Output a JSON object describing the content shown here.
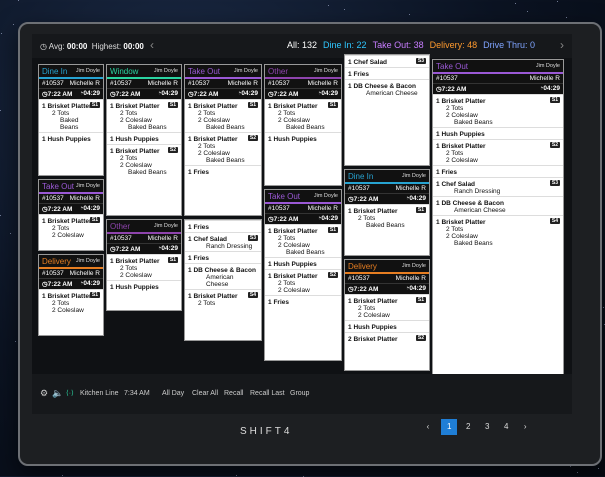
{
  "topbar": {
    "avg_label": "Avg:",
    "avg": "00:00",
    "highest_label": "Highest:",
    "highest": "00:00",
    "filters": [
      {
        "label": "All:",
        "count": "132",
        "color": "#ffffff"
      },
      {
        "label": "Dine In:",
        "count": "22",
        "color": "#2fc7ff"
      },
      {
        "label": "Take Out:",
        "count": "38",
        "color": "#c77dff"
      },
      {
        "label": "Delivery:",
        "count": "48",
        "color": "#ff9a2e"
      },
      {
        "label": "Drive Thru:",
        "count": "0",
        "color": "#7fa4ff"
      }
    ]
  },
  "tickets": [
    {
      "type": "Dine In",
      "color": "#27a3d1",
      "server": "Jim Doyle",
      "num": "#10537",
      "cust": "Michelle R",
      "time": "7:22 AM",
      "elapsed": "04:29",
      "items": [
        {
          "q": "1",
          "name": "Brisket Platter",
          "tag": "S1",
          "subs": [
            [
              "2",
              "Tots"
            ],
            [
              "",
              "Baked Beans"
            ]
          ]
        },
        {
          "q": "1",
          "name": "Hush Puppies",
          "tag": "",
          "subs": []
        }
      ]
    },
    {
      "type": "Window",
      "color": "#2bd4a1",
      "server": "Jim Doyle",
      "num": "#10537",
      "cust": "Michelle R",
      "time": "7:22 AM",
      "elapsed": "04:29",
      "items": [
        {
          "q": "1",
          "name": "Brisket Platter",
          "tag": "S1",
          "subs": [
            [
              "2",
              "Tots"
            ],
            [
              "2",
              "Coleslaw"
            ],
            [
              "",
              "Baked Beans"
            ]
          ]
        },
        {
          "q": "1",
          "name": "Hush Puppies",
          "tag": "",
          "subs": []
        },
        {
          "q": "1",
          "name": "Brisket Platter",
          "tag": "S2",
          "subs": [
            [
              "2",
              "Tots"
            ],
            [
              "2",
              "Coleslaw"
            ],
            [
              "",
              "Baked Beans"
            ]
          ]
        }
      ]
    },
    {
      "type": "Take Out",
      "color": "#9b59d6",
      "server": "Jim Doyle",
      "num": "#10537",
      "cust": "Michelle R",
      "time": "7:22 AM",
      "elapsed": "04:29",
      "items": [
        {
          "q": "1",
          "name": "Brisket Platter",
          "tag": "S1",
          "subs": [
            [
              "2",
              "Tots"
            ],
            [
              "2",
              "Coleslaw"
            ],
            [
              "",
              "Baked Beans"
            ]
          ]
        },
        {
          "q": "1",
          "name": "Brisket Platter",
          "tag": "S2",
          "subs": [
            [
              "2",
              "Tots"
            ],
            [
              "2",
              "Coleslaw"
            ],
            [
              "",
              "Baked Beans"
            ]
          ]
        },
        {
          "q": "1",
          "name": "Fries",
          "tag": "",
          "subs": []
        }
      ]
    },
    {
      "type": "Other",
      "color": "#8e44ad",
      "server": "Jim Doyle",
      "num": "#10537",
      "cust": "Michelle R",
      "time": "7:22 AM",
      "elapsed": "04:29",
      "items": [
        {
          "q": "1",
          "name": "Brisket Platter",
          "tag": "S1",
          "subs": [
            [
              "2",
              "Tots"
            ],
            [
              "2",
              "Coleslaw"
            ],
            [
              "",
              "Baked Beans"
            ]
          ]
        },
        {
          "q": "1",
          "name": "Hush Puppies",
          "tag": "",
          "subs": []
        }
      ]
    },
    {
      "type": "",
      "color": "#ffffff",
      "server": "",
      "num": "",
      "cust": "",
      "time": "",
      "elapsed": "",
      "items": [
        {
          "q": "1",
          "name": "Chef Salad",
          "tag": "S3",
          "subs": []
        },
        {
          "q": "1",
          "name": "Fries",
          "tag": "",
          "subs": []
        },
        {
          "q": "1",
          "name": "DB Cheese & Bacon",
          "tag": "",
          "subs": [
            [
              "",
              "American Cheese"
            ]
          ]
        }
      ]
    },
    {
      "type": "Take Out",
      "color": "#9b59d6",
      "server": "Jim Doyle",
      "num": "#10537",
      "cust": "Michelle R",
      "time": "7:22 AM",
      "elapsed": "04:29",
      "items": [
        {
          "q": "1",
          "name": "Brisket Platter",
          "tag": "S1",
          "subs": [
            [
              "2",
              "Tots"
            ],
            [
              "2",
              "Coleslaw"
            ],
            [
              "",
              "Baked Beans"
            ]
          ]
        },
        {
          "q": "1",
          "name": "Hush Puppies",
          "tag": "",
          "subs": []
        },
        {
          "q": "1",
          "name": "Brisket Platter",
          "tag": "S2",
          "subs": [
            [
              "2",
              "Tots"
            ],
            [
              "2",
              "Coleslaw"
            ]
          ]
        },
        {
          "q": "1",
          "name": "Fries",
          "tag": "",
          "subs": []
        },
        {
          "q": "1",
          "name": "Chef Salad",
          "tag": "S3",
          "subs": [
            [
              "",
              "Ranch Dressing"
            ]
          ]
        },
        {
          "q": "1",
          "name": "DB Cheese & Bacon",
          "tag": "",
          "subs": [
            [
              "",
              "American Cheese"
            ]
          ]
        },
        {
          "q": "1",
          "name": "Brisket Platter",
          "tag": "S4",
          "subs": [
            [
              "2",
              "Tots"
            ],
            [
              "2",
              "Coleslaw"
            ],
            [
              "",
              "Baked Beans"
            ]
          ]
        }
      ]
    },
    {
      "type": "Take Out",
      "color": "#9b59d6",
      "server": "Jim Doyle",
      "num": "#10537",
      "cust": "Michelle R",
      "time": "7:22 AM",
      "elapsed": "04:29",
      "items": [
        {
          "q": "1",
          "name": "Brisket Platter",
          "tag": "S1",
          "subs": [
            [
              "2",
              "Tots"
            ],
            [
              "2",
              "Coleslaw"
            ]
          ]
        }
      ]
    },
    {
      "type": "Other",
      "color": "#8e44ad",
      "server": "Jim Doyle",
      "num": "#10537",
      "cust": "Michelle R",
      "time": "7:22 AM",
      "elapsed": "04:29",
      "items": [
        {
          "q": "1",
          "name": "Brisket Platter",
          "tag": "S1",
          "subs": [
            [
              "2",
              "Tots"
            ],
            [
              "2",
              "Coleslaw"
            ]
          ]
        },
        {
          "q": "1",
          "name": "Hush Puppies",
          "tag": "",
          "subs": []
        }
      ]
    },
    {
      "type": "Delivery",
      "color": "#e67e22",
      "server": "Jim Doyle",
      "num": "#10537",
      "cust": "Michelle R",
      "time": "7:22 AM",
      "elapsed": "04:29",
      "items": [
        {
          "q": "1",
          "name": "Brisket Platter",
          "tag": "S1",
          "subs": [
            [
              "2",
              "Tots"
            ],
            [
              "2",
              "Coleslaw"
            ]
          ]
        }
      ]
    },
    {
      "type": "",
      "color": "#ffffff",
      "server": "",
      "num": "",
      "cust": "",
      "time": "",
      "elapsed": "",
      "items": [
        {
          "q": "1",
          "name": "Fries",
          "tag": "",
          "subs": []
        },
        {
          "q": "1",
          "name": "Chef Salad",
          "tag": "S3",
          "subs": [
            [
              "",
              "Ranch Dressing"
            ]
          ]
        },
        {
          "q": "1",
          "name": "Fries",
          "tag": "",
          "subs": []
        },
        {
          "q": "1",
          "name": "DB Cheese & Bacon",
          "tag": "",
          "subs": [
            [
              "",
              "American Cheese"
            ]
          ]
        },
        {
          "q": "1",
          "name": "Brisket Platter",
          "tag": "S4",
          "subs": [
            [
              "2",
              "Tots"
            ]
          ]
        }
      ]
    },
    {
      "type": "Take Out",
      "color": "#9b59d6",
      "server": "Jim Doyle",
      "num": "#10537",
      "cust": "Michelle R",
      "time": "7:22 AM",
      "elapsed": "04:29",
      "items": [
        {
          "q": "1",
          "name": "Brisket Platter",
          "tag": "S1",
          "subs": [
            [
              "2",
              "Tots"
            ],
            [
              "2",
              "Coleslaw"
            ],
            [
              "",
              "Baked Beans"
            ]
          ]
        },
        {
          "q": "1",
          "name": "Hush Puppies",
          "tag": "",
          "subs": []
        },
        {
          "q": "1",
          "name": "Brisket Platter",
          "tag": "S2",
          "subs": [
            [
              "2",
              "Tots"
            ],
            [
              "2",
              "Coleslaw"
            ]
          ]
        },
        {
          "q": "1",
          "name": "Fries",
          "tag": "",
          "subs": []
        }
      ]
    },
    {
      "type": "Dine In",
      "color": "#27a3d1",
      "server": "Jim Doyle",
      "num": "#10537",
      "cust": "Michelle R",
      "time": "7:22 AM",
      "elapsed": "04:29",
      "items": [
        {
          "q": "1",
          "name": "Brisket Platter",
          "tag": "S1",
          "subs": [
            [
              "2",
              "Tots"
            ],
            [
              "",
              "Baked Beans"
            ]
          ]
        }
      ]
    },
    {
      "type": "Delivery",
      "color": "#e67e22",
      "server": "Jim Doyle",
      "num": "#10537",
      "cust": "Michelle R",
      "time": "7:22 AM",
      "elapsed": "04:29",
      "items": [
        {
          "q": "1",
          "name": "Brisket Platter",
          "tag": "S1",
          "subs": [
            [
              "2",
              "Tots"
            ],
            [
              "2",
              "Coleslaw"
            ]
          ]
        },
        {
          "q": "1",
          "name": "Hush Puppies",
          "tag": "",
          "subs": []
        },
        {
          "q": "2",
          "name": "Brisket Platter",
          "tag": "S2",
          "subs": []
        }
      ]
    }
  ],
  "bottom": {
    "kitchen_line": "Kitchen Line",
    "time": "7:34 AM",
    "buttons": [
      "All Day",
      "Clear All",
      "Recall",
      "Recall Last",
      "Group"
    ]
  },
  "brand": "SHIFT4",
  "pages": [
    "1",
    "2",
    "3",
    "4"
  ]
}
